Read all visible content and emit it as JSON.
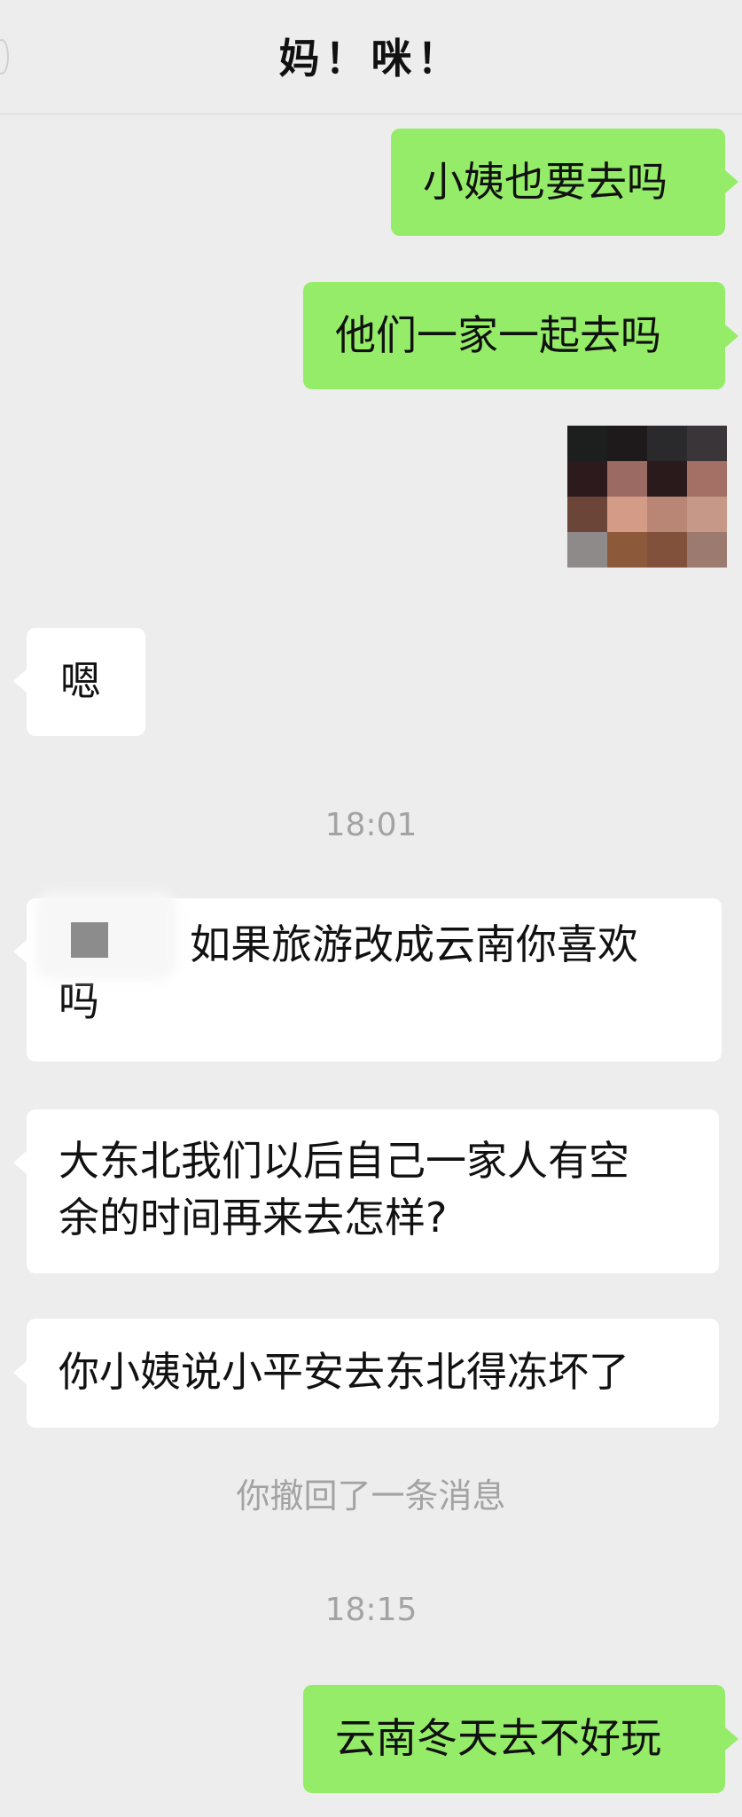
{
  "header": {
    "title": "妈！咪！"
  },
  "messages": {
    "m1": "小姨也要去吗",
    "m2": "他们一家一起去吗",
    "m3": "嗯",
    "t1": "18:01",
    "m4_line1": "如果旅游改成云南你喜欢",
    "m4_line2": "吗",
    "m5_line1": "大东北我们以后自己一家人有空",
    "m5_line2": "余的时间再来去怎样?",
    "m6": "你小姨说小平安去东北得冻坏了",
    "notice": "你撤回了一条消息",
    "t2": "18:15",
    "m7": "云南冬天去不好玩"
  },
  "photo": {
    "pixel_colors": [
      "#1c1f1e",
      "#1e1a1b",
      "#2a2a2c",
      "#3a3538",
      "#2d1a1d",
      "#9b6a62",
      "#2a1a1c",
      "#a47066",
      "#6a4538",
      "#d49c86",
      "#b98574",
      "#c69888",
      "#8e8a89",
      "#8c5a3b",
      "#82513c",
      "#9c7a70"
    ]
  }
}
